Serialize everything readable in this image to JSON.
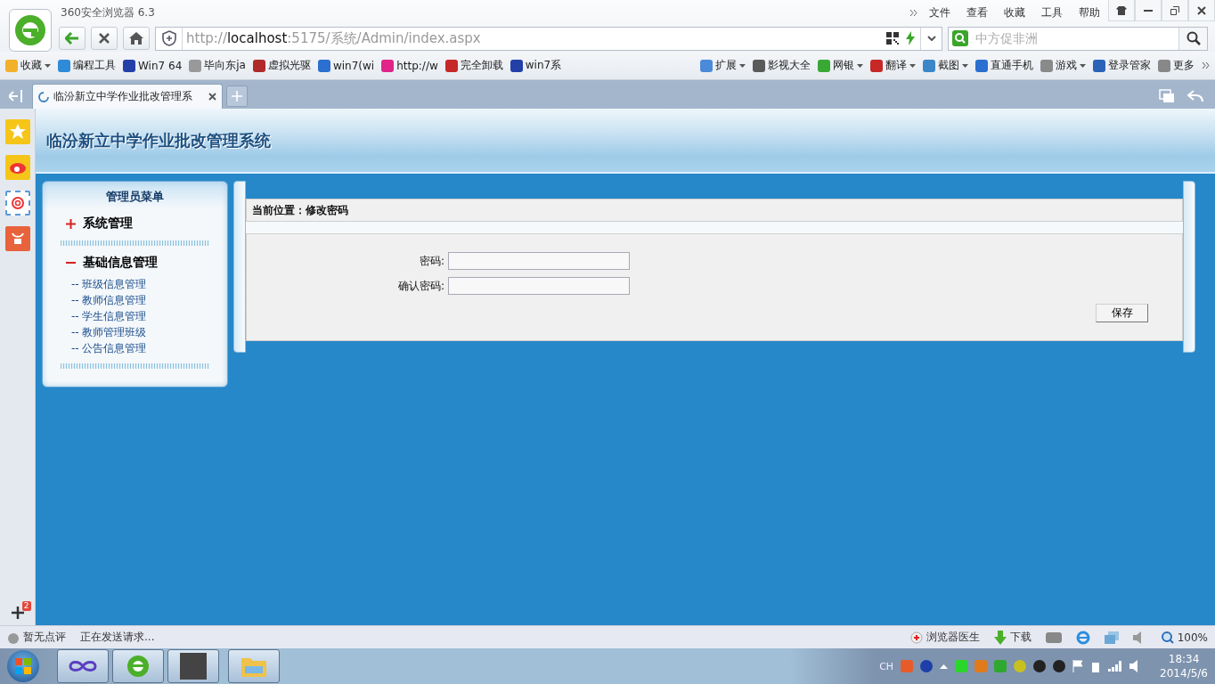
{
  "browser": {
    "title": "360安全浏览器 6.3",
    "menu": [
      "文件",
      "查看",
      "收藏",
      "工具",
      "帮助"
    ],
    "address": {
      "parts": [
        {
          "text": "http://",
          "emphasis": false
        },
        {
          "text": "localhost",
          "emphasis": true
        },
        {
          "text": ":5175/系统/Admin/index.aspx",
          "emphasis": false
        }
      ]
    },
    "search": {
      "placeholder": "中方促非洲"
    },
    "bookmarks": [
      {
        "label": "收藏",
        "dropdown": true
      },
      {
        "label": "编程工具",
        "dropdown": false
      },
      {
        "label": "Win7 64",
        "dropdown": false
      },
      {
        "label": "毕向东ja",
        "dropdown": false
      },
      {
        "label": "虚拟光驱",
        "dropdown": false
      },
      {
        "label": "win7(wi",
        "dropdown": false
      },
      {
        "label": "http://w",
        "dropdown": false
      },
      {
        "label": "完全卸载",
        "dropdown": false
      },
      {
        "label": "win7系",
        "dropdown": false
      }
    ],
    "tools": [
      {
        "label": "扩展",
        "dropdown": true
      },
      {
        "label": "影视大全",
        "dropdown": false
      },
      {
        "label": "网银",
        "dropdown": true
      },
      {
        "label": "翻译",
        "dropdown": true
      },
      {
        "label": "截图",
        "dropdown": true
      },
      {
        "label": "直通手机",
        "dropdown": false
      },
      {
        "label": "游戏",
        "dropdown": true
      },
      {
        "label": "登录管家",
        "dropdown": false
      },
      {
        "label": "更多",
        "dropdown": false
      }
    ],
    "tabs": [
      {
        "label": "临汾新立中学作业批改管理系",
        "selected": true,
        "loading": true
      }
    ],
    "sidebar_badge": "2"
  },
  "page": {
    "title": "临汾新立中学作业批改管理系统",
    "menu": {
      "title": "管理员菜单",
      "groups": [
        {
          "label": "系统管理",
          "expanded": false
        },
        {
          "label": "基础信息管理",
          "expanded": true,
          "children": [
            {
              "label": "-- 班级信息管理"
            },
            {
              "label": "-- 教师信息管理"
            },
            {
              "label": "-- 学生信息管理"
            },
            {
              "label": "-- 教师管理班级"
            },
            {
              "label": "-- 公告信息管理"
            }
          ]
        }
      ]
    },
    "breadcrumb": "当前位置：修改密码",
    "form": {
      "fields": [
        {
          "label": "密码:"
        },
        {
          "label": "确认密码:"
        }
      ],
      "button": "保存"
    }
  },
  "status_bar": {
    "left": [
      "暂无点评",
      "正在发送请求..."
    ],
    "doctor": "浏览器医生",
    "download": "下载",
    "zoom": "100%"
  },
  "taskbar": {
    "input_method": "CH",
    "time": "18:34",
    "date": "2014/5/6"
  }
}
